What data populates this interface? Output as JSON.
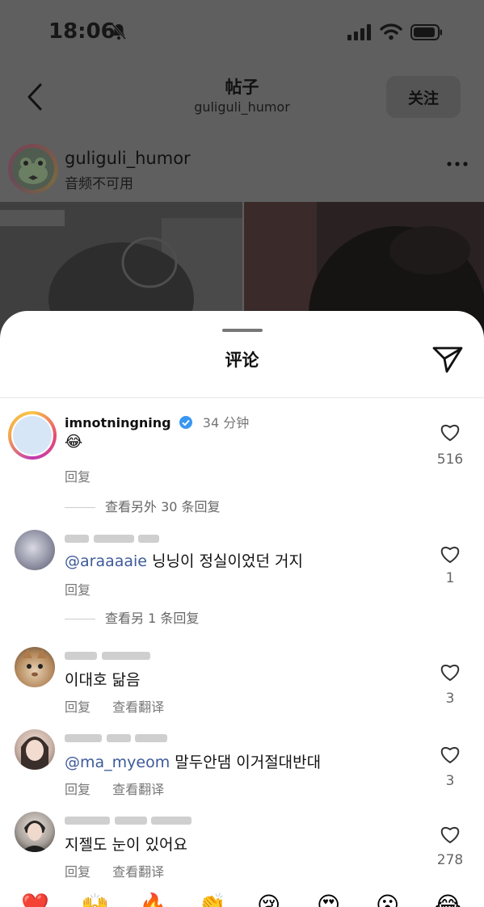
{
  "status": {
    "time": "18:06"
  },
  "nav": {
    "title": "帖子",
    "subtitle": "guliguli_humor",
    "follow": "关注"
  },
  "post": {
    "username": "guliguli_humor",
    "subtitle": "音频不可用"
  },
  "sheet": {
    "title": "评论"
  },
  "comments": [
    {
      "username": "imnotningning",
      "time": "34 分钟",
      "text": "😂",
      "reply": "回复",
      "likes": "516",
      "view_replies": "查看另外 30 条回复"
    },
    {
      "username": "",
      "mention": "@araaaaie",
      "text": " 닝닝이 정실이었던 거지",
      "reply": "回复",
      "likes": "1",
      "view_replies": "查看另 1 条回复"
    },
    {
      "username": "",
      "text": "이대호 닮음",
      "reply": "回复",
      "translate": "查看翻译",
      "likes": "3"
    },
    {
      "username": "",
      "mention": "@ma_myeom",
      "text": " 말두안댐 이거절대반대",
      "reply": "回复",
      "translate": "查看翻译",
      "likes": "3"
    },
    {
      "username": "",
      "text": "지젤도 눈이 있어요",
      "reply": "回复",
      "translate": "查看翻译",
      "likes": "278"
    }
  ],
  "emoji_bar": [
    "❤️",
    "🙌",
    "🔥",
    "👏",
    "😢",
    "😍",
    "😮",
    "😂"
  ]
}
